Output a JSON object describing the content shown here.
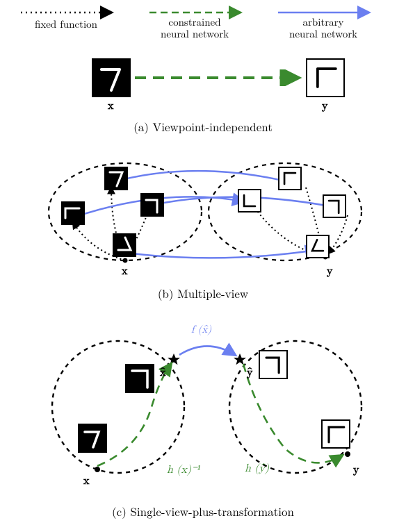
{
  "legend": {
    "fixed": "fixed function",
    "constrained_l1": "constrained",
    "constrained_l2": "neural network",
    "arbitrary_l1": "arbitrary",
    "arbitrary_l2": "neural network"
  },
  "colors": {
    "black": "#000000",
    "green": "#3a8a2e",
    "blue": "#6b7ff0"
  },
  "vars": {
    "x": "x",
    "y": "y",
    "xhat": "x̂",
    "yhat": "ŷ"
  },
  "panelA": {
    "caption": "(a) Viewpoint-independent",
    "x_label": "x",
    "y_label": "y"
  },
  "panelB": {
    "caption": "(b) Multiple-view",
    "x_label": "x",
    "y_label": "y"
  },
  "panelC": {
    "caption": "(c) Single-view-plus-transformation",
    "x_label": "x",
    "y_label": "y",
    "f_label": "f (x̂)",
    "hinv_label": "h (x)⁻¹",
    "h_label": "h (ŷ)"
  }
}
